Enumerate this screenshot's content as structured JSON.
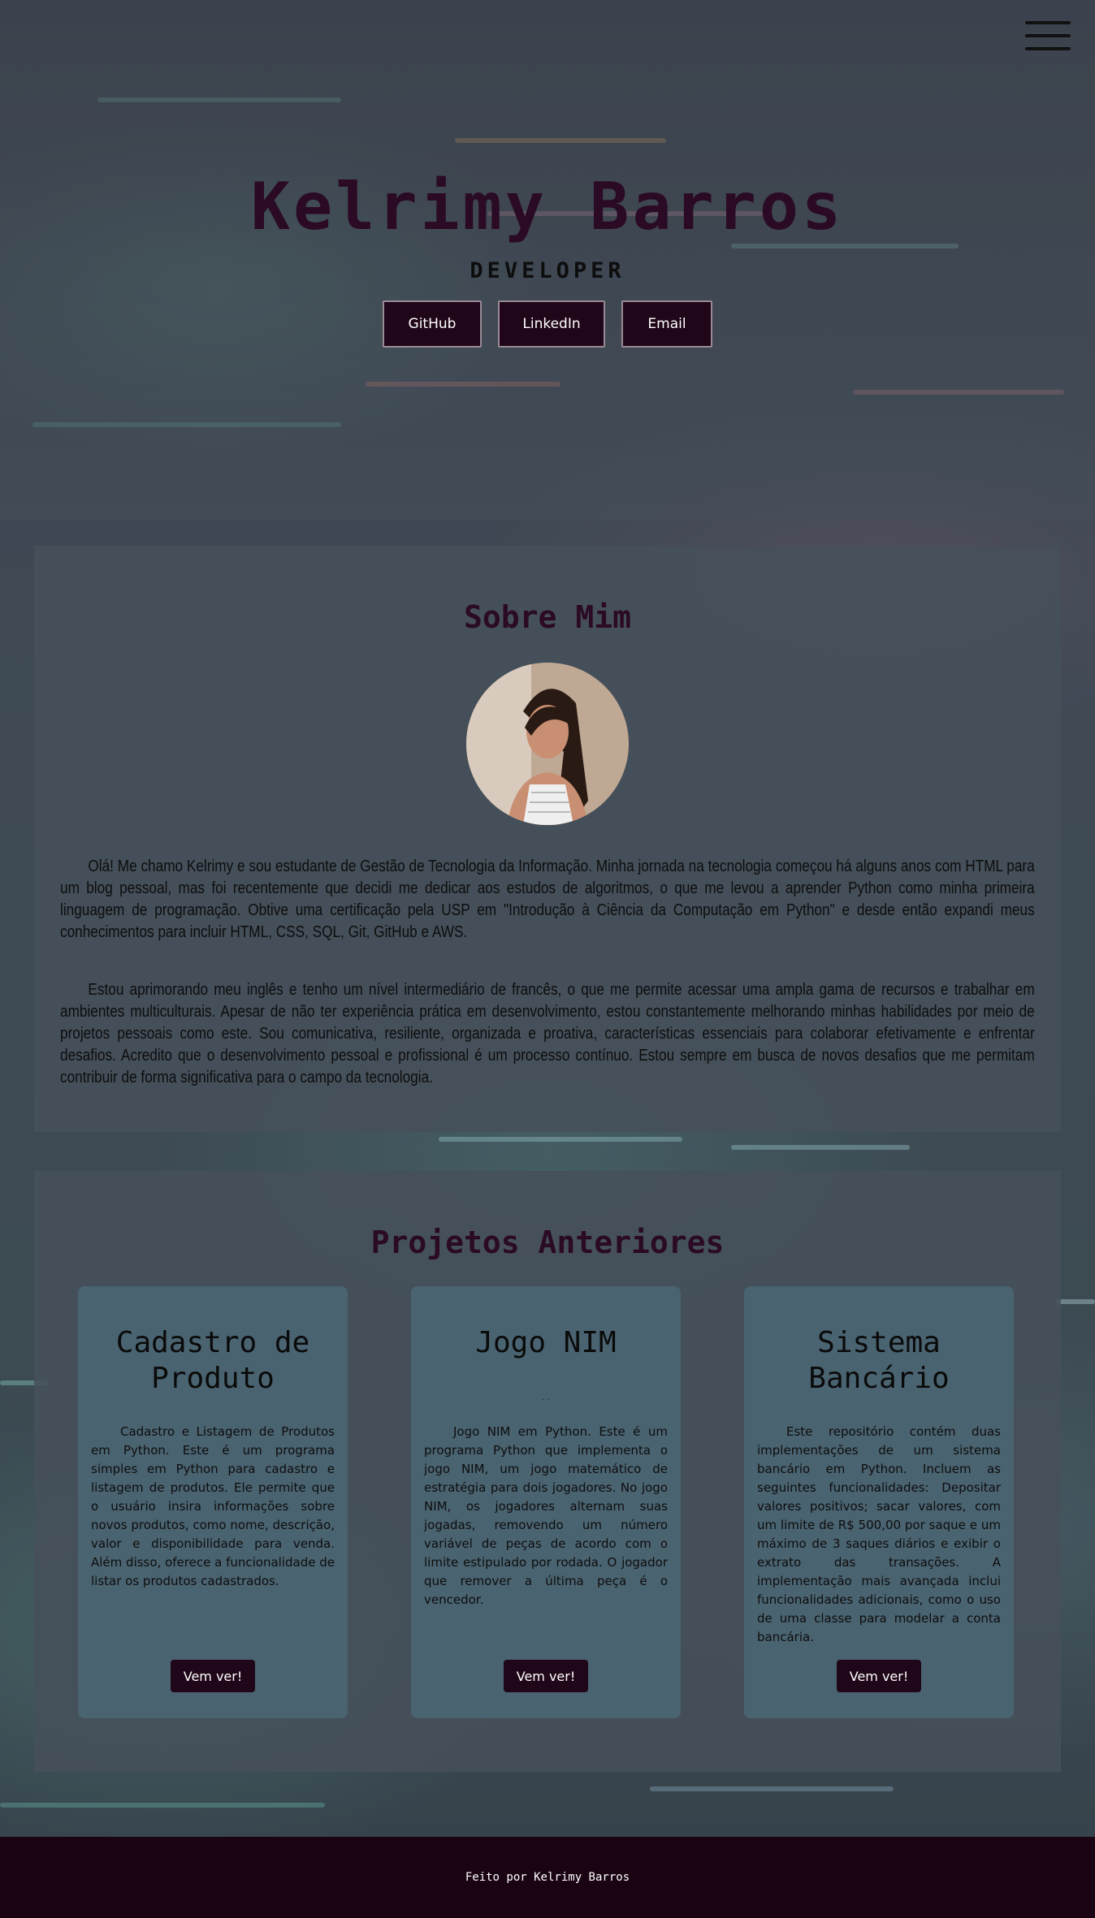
{
  "header": {
    "menu_icon": "hamburger-menu-icon",
    "name": "Kelrimy Barros",
    "role": "DEVELOPER",
    "links": [
      {
        "label": "GitHub"
      },
      {
        "label": "LinkedIn"
      },
      {
        "label": "Email"
      }
    ]
  },
  "about": {
    "title": "Sobre Mim",
    "paragraphs": [
      "Olá! Me chamo Kelrimy e sou estudante de Gestão de Tecnologia da Informação. Minha jornada na tecnologia começou há alguns anos com HTML para um blog pessoal, mas foi recentemente que decidi me dedicar aos estudos de algoritmos, o que me levou a aprender Python como minha primeira linguagem de programação. Obtive uma certificação pela USP em \"Introdução à Ciência da Computação em Python\" e desde então expandi meus conhecimentos para incluir HTML, CSS, SQL, Git, GitHub e AWS.",
      "Estou aprimorando meu inglês e tenho um nível intermediário de francês, o que me permite acessar uma ampla gama de recursos e trabalhar em ambientes multiculturais. Apesar de não ter experiência prática em desenvolvimento, estou constantemente melhorando minhas habilidades por meio de projetos pessoais como este. Sou comunicativa, resiliente, organizada e proativa, características essenciais para colaborar efetivamente e enfrentar desafios. Acredito que o desenvolvimento pessoal e profissional é um processo contínuo. Estou sempre em busca de novos desafios que me permitam contribuir de forma significativa para o campo da tecnologia."
    ]
  },
  "projects": {
    "title": "Projetos Anteriores",
    "cards": [
      {
        "title": "Cadastro de Produto",
        "description": "Cadastro e Listagem de Produtos em Python. Este é um programa simples em Python para cadastro e listagem de produtos. Ele permite que o usuário insira informações sobre novos produtos, como nome, descrição, valor e disponibilidade para venda. Além disso, oferece a funcionalidade de listar os produtos cadastrados.",
        "button": "Vem ver!"
      },
      {
        "title": "Jogo NIM",
        "dots": ". .",
        "description": "Jogo NIM em Python. Este é um programa Python que implementa o jogo NIM, um jogo matemático de estratégia para dois jogadores. No jogo NIM, os jogadores alternam suas jogadas, removendo um número variável de peças de acordo com o limite estipulado por rodada. O jogador que remover a última peça é o vencedor.",
        "button": "Vem ver!"
      },
      {
        "title": "Sistema Bancário",
        "description": "Este repositório contém duas implementações de um sistema bancário em Python. Incluem as seguintes funcionalidades: Depositar valores positivos; sacar valores, com um limite de R$ 500,00 por saque e um máximo de 3 saques diários e exibir o extrato das transações. A implementação mais avançada inclui funcionalidades adicionais, como o uso de uma classe para modelar a conta bancária.",
        "button": "Vem ver!"
      }
    ]
  },
  "footer": {
    "text": "Feito por Kelrimy Barros"
  }
}
